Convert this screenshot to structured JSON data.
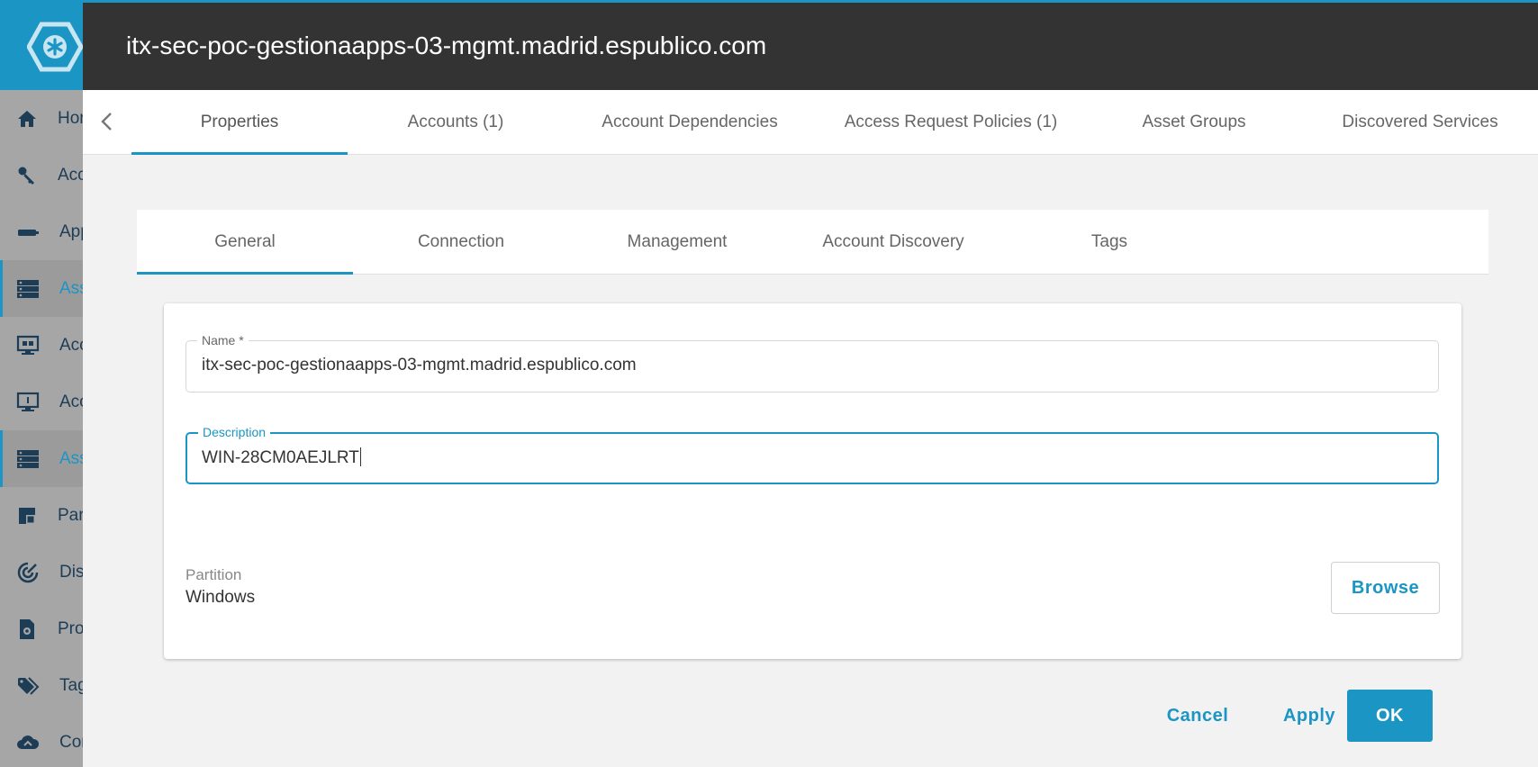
{
  "app_nav": {
    "items": [
      {
        "label": "Home",
        "icon": "home-icon",
        "active": false
      },
      {
        "label": "Access",
        "icon": "key-icon",
        "active": false
      },
      {
        "label": "Applications",
        "icon": "application-icon",
        "active": false
      },
      {
        "label": "Assets",
        "icon": "server-stack-icon",
        "active": true
      },
      {
        "label": "Access Requests",
        "icon": "monitor-icon",
        "active": false
      },
      {
        "label": "Accounts",
        "icon": "desktop-icon",
        "active": false
      },
      {
        "label": "Assets",
        "icon": "server-stack-icon",
        "active": true
      },
      {
        "label": "Partitions",
        "icon": "partition-icon",
        "active": false
      },
      {
        "label": "Discovery",
        "icon": "radar-icon",
        "active": false
      },
      {
        "label": "Profiles",
        "icon": "profile-gear-icon",
        "active": false
      },
      {
        "label": "Tags",
        "icon": "tag-icon",
        "active": false
      },
      {
        "label": "Connections",
        "icon": "cloud-icon",
        "active": false
      }
    ]
  },
  "dialog": {
    "title": "itx-sec-poc-gestionaapps-03-mgmt.madrid.espublico.com",
    "tabs": [
      {
        "label": "Properties",
        "active": true
      },
      {
        "label": "Accounts (1)",
        "active": false
      },
      {
        "label": "Account Dependencies",
        "active": false
      },
      {
        "label": "Access Request Policies (1)",
        "active": false
      },
      {
        "label": "Asset Groups",
        "active": false
      },
      {
        "label": "Discovered Services",
        "active": false
      }
    ],
    "subtabs": [
      {
        "label": "General",
        "active": true
      },
      {
        "label": "Connection",
        "active": false
      },
      {
        "label": "Management",
        "active": false
      },
      {
        "label": "Account Discovery",
        "active": false
      },
      {
        "label": "Tags",
        "active": false
      }
    ],
    "form": {
      "name_label": "Name *",
      "name_value": "itx-sec-poc-gestionaapps-03-mgmt.madrid.espublico.com",
      "description_label": "Description",
      "description_value": "WIN-28CM0AEJLRT",
      "partition_label": "Partition",
      "partition_value": "Windows",
      "browse_label": "Browse"
    },
    "footer": {
      "cancel_label": "Cancel",
      "apply_label": "Apply",
      "ok_label": "OK"
    }
  },
  "colors": {
    "accent": "#1a95c4",
    "header_bg": "#333333",
    "nav_bg": "#a6a6a6",
    "nav_icon": "#1d3c55"
  }
}
